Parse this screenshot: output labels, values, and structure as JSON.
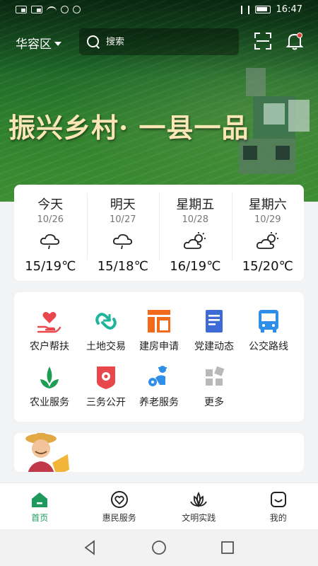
{
  "status_bar": {
    "time": "16:47"
  },
  "header": {
    "region": "华容区",
    "search_placeholder": "搜索"
  },
  "banner": {
    "slogan": "振兴乡村· 一县一品"
  },
  "weather": [
    {
      "day": "今天",
      "date": "10/26",
      "icon": "cloud-rain-icon",
      "temp": "15/19℃"
    },
    {
      "day": "明天",
      "date": "10/27",
      "icon": "cloud-rain-icon",
      "temp": "15/18℃"
    },
    {
      "day": "星期五",
      "date": "10/28",
      "icon": "partly-sunny-icon",
      "temp": "16/19℃"
    },
    {
      "day": "星期六",
      "date": "10/29",
      "icon": "partly-sunny-icon",
      "temp": "15/20℃"
    }
  ],
  "services": [
    {
      "label": "农户帮扶",
      "icon": "heart-hand-icon",
      "color": "#e8474b"
    },
    {
      "label": "土地交易",
      "icon": "exchange-icon",
      "color": "#1fb59a"
    },
    {
      "label": "建房申请",
      "icon": "building-plan-icon",
      "color": "#f26b1d"
    },
    {
      "label": "党建动态",
      "icon": "document-icon",
      "color": "#3d6ad6"
    },
    {
      "label": "公交路线",
      "icon": "bus-icon",
      "color": "#2f8fe8"
    },
    {
      "label": "农业服务",
      "icon": "sprout-icon",
      "color": "#1e9d55"
    },
    {
      "label": "三务公开",
      "icon": "badge-icon",
      "color": "#e8474b"
    },
    {
      "label": "养老服务",
      "icon": "elderly-icon",
      "color": "#2f8fe8"
    },
    {
      "label": "更多",
      "icon": "more-grid-icon",
      "color": "#b9b9b9"
    }
  ],
  "tabs": [
    {
      "label": "首页",
      "icon": "home-icon",
      "active": true
    },
    {
      "label": "惠民服务",
      "icon": "smile-heart-icon",
      "active": false
    },
    {
      "label": "文明实践",
      "icon": "lotus-icon",
      "active": false
    },
    {
      "label": "我的",
      "icon": "profile-smile-icon",
      "active": false
    }
  ],
  "colors": {
    "accent": "#1d9a5b",
    "slogan": "#fbe7b5"
  }
}
